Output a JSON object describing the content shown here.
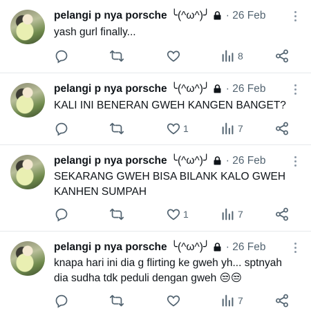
{
  "author": {
    "name": "pelangi p nya porsche",
    "emoticon": "╰(^ω^)╯"
  },
  "icons": {
    "reply": "reply-icon",
    "retweet": "retweet-icon",
    "like": "heart-icon",
    "views": "analytics-icon",
    "share": "share-icon",
    "lock": "lock-icon",
    "more": "more-vertical-icon"
  },
  "tweets": [
    {
      "date": "· 26 Feb",
      "text": "yash gurl finally...",
      "likes": "",
      "views": "8"
    },
    {
      "date": "· 26 Feb",
      "text": "KALI INI BENERAN GWEH KANGEN BANGET?",
      "likes": "1",
      "views": "7"
    },
    {
      "date": "· 26 Feb",
      "text": "SEKARANG GWEH BISA BILANK KALO GWEH KANHEN SUMPAH",
      "likes": "1",
      "views": "7"
    },
    {
      "date": "· 26 Feb",
      "text": "knapa hari ini dia g flirting ke gweh yh... sptnyah dia sudha tdk peduli dengan gweh",
      "emoji": "😒😒",
      "likes": "",
      "views": "7"
    }
  ]
}
